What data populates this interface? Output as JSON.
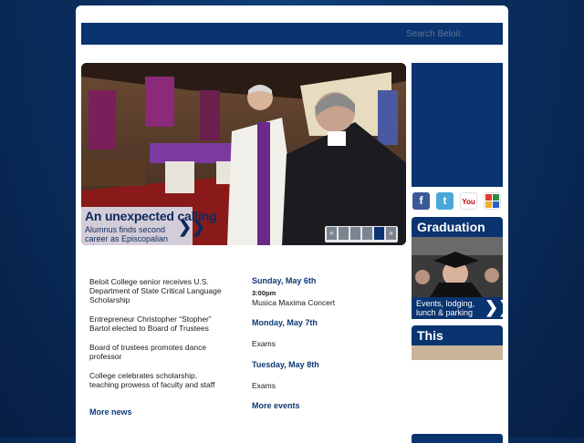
{
  "header": {
    "search_placeholder": "Search Beloit"
  },
  "hero": {
    "title": "An unexpected calling",
    "subtitle": "Alumnus finds second career as Episcopalian priest",
    "arrow": "❯❯",
    "nav": {
      "prev": "«",
      "next": "»",
      "slides": [
        "",
        "",
        "",
        ""
      ],
      "active_slide": 4
    }
  },
  "social": {
    "icons": [
      "facebook-icon",
      "twitter-icon",
      "youtube-icon",
      "picasa-icon"
    ],
    "facebook_glyph": "f",
    "twitter_glyph": "t",
    "youtube_glyph": "You"
  },
  "promos": {
    "graduation": {
      "title": "Graduation",
      "text": "Events, lodging, lunch & parking",
      "arrow": "❯❯"
    },
    "summer": {
      "title": "This Summer"
    }
  },
  "news": {
    "items": [
      "Beloit College senior receives U.S. Department of State Critical Language Scholarship",
      "Entrepreneur Christopher “Stopher” Bartol elected to Board of Trustees",
      "Board of trustees promotes dance professor",
      "College celebrates scholarship, teaching prowess of faculty and staff"
    ],
    "more_label": "More news"
  },
  "events": {
    "days": [
      {
        "date": "Sunday, May 6th",
        "time": "3:00pm",
        "title": "Musica Maxima Concert"
      },
      {
        "date": "Monday, May 7th",
        "time": "",
        "title": "Exams"
      },
      {
        "date": "Tuesday, May 8th",
        "time": "",
        "title": "Exams"
      }
    ],
    "more_label": "More events"
  },
  "colors": {
    "brand_navy": "#0a3470",
    "link_blue": "#0c3a78",
    "background": "#0a2f60"
  }
}
